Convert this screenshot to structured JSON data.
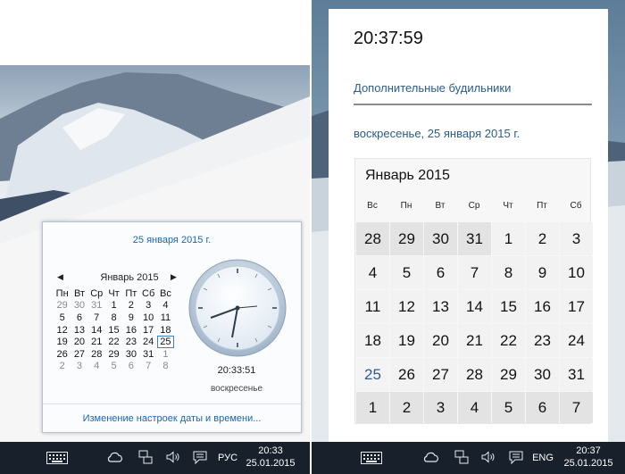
{
  "left": {
    "popup": {
      "date_title": "25 января 2015 г.",
      "month_label": "Январь 2015",
      "prev_icon": "triangle-left-icon",
      "next_icon": "triangle-right-icon",
      "weekdays": [
        "Пн",
        "Вт",
        "Ср",
        "Чт",
        "Пт",
        "Сб",
        "Вс"
      ],
      "weeks": [
        [
          "29",
          "30",
          "31",
          "1",
          "2",
          "3",
          "4"
        ],
        [
          "5",
          "6",
          "7",
          "8",
          "9",
          "10",
          "11"
        ],
        [
          "12",
          "13",
          "14",
          "15",
          "16",
          "17",
          "18"
        ],
        [
          "19",
          "20",
          "21",
          "22",
          "23",
          "24",
          "25"
        ],
        [
          "26",
          "27",
          "28",
          "29",
          "30",
          "31",
          "1"
        ],
        [
          "2",
          "3",
          "4",
          "5",
          "6",
          "7",
          "8"
        ]
      ],
      "selected_day": "25",
      "clock_time": "20:33:51",
      "day_of_week": "воскресенье",
      "footer_link": "Изменение настроек даты и времени..."
    },
    "taskbar": {
      "icons": [
        "keyboard-icon",
        "cloud-icon",
        "network-icon",
        "volume-icon",
        "action-center-icon"
      ],
      "language": "РУС",
      "time": "20:33",
      "date": "25.01.2015"
    }
  },
  "right": {
    "flyout": {
      "time": "20:37:59",
      "alarms_link": "Дополнительные будильники",
      "long_date": "воскресенье, 25 января 2015 г.",
      "month_label": "Январь 2015",
      "weekdays": [
        "Вс",
        "Пн",
        "Вт",
        "Ср",
        "Чт",
        "Пт",
        "Сб"
      ],
      "weeks": [
        [
          "28",
          "29",
          "30",
          "31",
          "1",
          "2",
          "3"
        ],
        [
          "4",
          "5",
          "6",
          "7",
          "8",
          "9",
          "10"
        ],
        [
          "11",
          "12",
          "13",
          "14",
          "15",
          "16",
          "17"
        ],
        [
          "18",
          "19",
          "20",
          "21",
          "22",
          "23",
          "24"
        ],
        [
          "25",
          "26",
          "27",
          "28",
          "29",
          "30",
          "31"
        ],
        [
          "1",
          "2",
          "3",
          "4",
          "5",
          "6",
          "7"
        ]
      ],
      "selected_day": "25"
    },
    "taskbar": {
      "icons": [
        "keyboard-icon",
        "cloud-icon",
        "network-icon",
        "volume-icon",
        "action-center-icon"
      ],
      "language": "ENG",
      "time": "20:37",
      "date": "25.01.2015"
    }
  },
  "colors": {
    "accent": "#1a66b3",
    "link_blue": "#2b5c8a",
    "taskbar": "#18202c"
  }
}
